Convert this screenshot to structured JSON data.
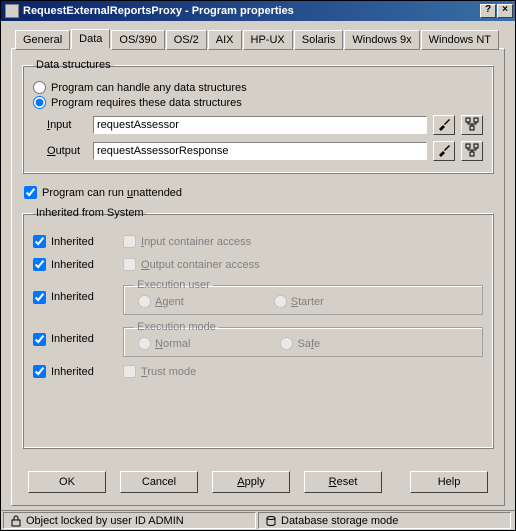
{
  "title": "RequestExternalReportsProxy - Program properties",
  "tabs": [
    "General",
    "Data",
    "OS/390",
    "OS/2",
    "AIX",
    "HP-UX",
    "Solaris",
    "Windows 9x",
    "Windows NT"
  ],
  "active_tab": 1,
  "data_structures": {
    "legend": "Data structures",
    "opt_any": "Program can handle any data structures",
    "opt_req": "Program requires these data structures",
    "selected": "req",
    "input_label": "Input",
    "input_value": "requestAssessor",
    "output_label": "Output",
    "output_value": "requestAssessorResponse"
  },
  "unattended": {
    "label": "Program can run unattended",
    "checked": true
  },
  "inherited": {
    "legend": "Inherited from System",
    "inh_label": "Inherited",
    "input_container": "Input container access",
    "output_container": "Output container access",
    "exec_user": {
      "legend": "Execution user",
      "agent": "Agent",
      "starter": "Starter"
    },
    "exec_mode": {
      "legend": "Execution mode",
      "normal": "Normal",
      "safe": "Safe"
    },
    "trust_mode": "Trust mode"
  },
  "buttons": {
    "ok": "OK",
    "cancel": "Cancel",
    "apply": "Apply",
    "reset": "Reset",
    "help": "Help"
  },
  "status": {
    "left": "Object locked by user ID ADMIN",
    "right": "Database storage mode"
  }
}
